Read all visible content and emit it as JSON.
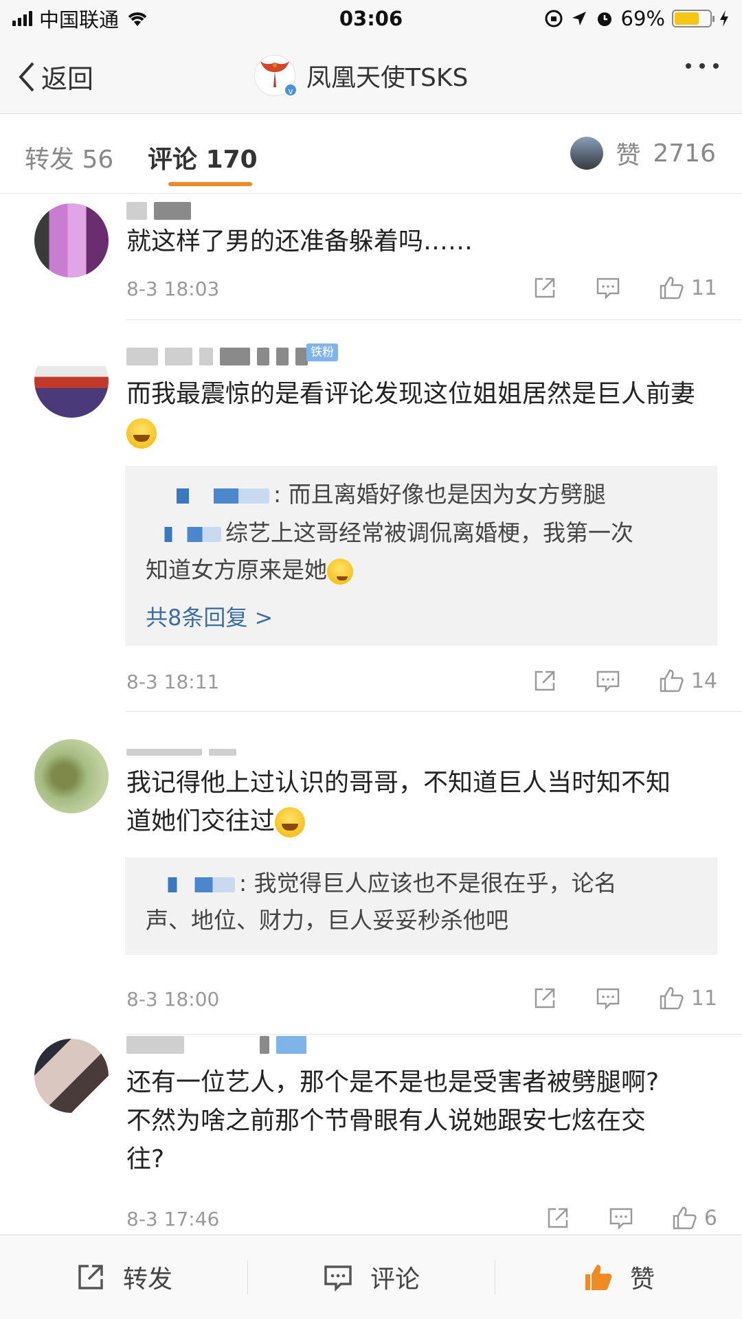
{
  "status_bar": {
    "carrier": "中国联通",
    "time": "03:06",
    "battery_percent": "69%",
    "battery_level": 0.69
  },
  "nav": {
    "back_label": "返回",
    "title": "凤凰天使TSKS"
  },
  "tabs": {
    "repost_label": "转发",
    "repost_count": "56",
    "comment_label": "评论",
    "comment_count": "170",
    "like_label": "赞",
    "like_count": "2716"
  },
  "comments": [
    {
      "text": "就这样了男的还准备躲着吗……",
      "time": "8-3 18:03",
      "likes": "11"
    },
    {
      "badge": "铁粉",
      "text": "而我最震惊的是看评论发现这位姐姐居然是巨人前妻",
      "reply_1": ": 而且离婚好像也是因为女方劈腿",
      "reply_2_line1": "综艺上这哥经常被调侃离婚梗，我第一次",
      "reply_2_line2": "知道女方原来是她",
      "more_replies": "共8条回复 >",
      "time": "8-3 18:11",
      "likes": "14"
    },
    {
      "text_line1": "我记得他上过认识的哥哥，不知道巨人当时知不知",
      "text_line2": "道她们交往过",
      "reply_line1": ": 我觉得巨人应该也不是很在乎，论名",
      "reply_line2": "声、地位、财力，巨人妥妥秒杀他吧",
      "time": "8-3 18:00",
      "likes": "11"
    },
    {
      "text_line1": "还有一位艺人，那个是不是也是受害者被劈腿啊?",
      "text_line2": "不然为啥之前那个节骨眼有人说她跟安七炫在交",
      "text_line3": "往?",
      "time": "8-3 17:46",
      "likes": "6"
    }
  ],
  "bottom_bar": {
    "repost_label": "转发",
    "comment_label": "评论",
    "like_label": "赞"
  },
  "colors": {
    "accent_orange": "#f08a24",
    "link_blue": "#3a6ea5",
    "badge_blue": "#7fb4ea"
  }
}
